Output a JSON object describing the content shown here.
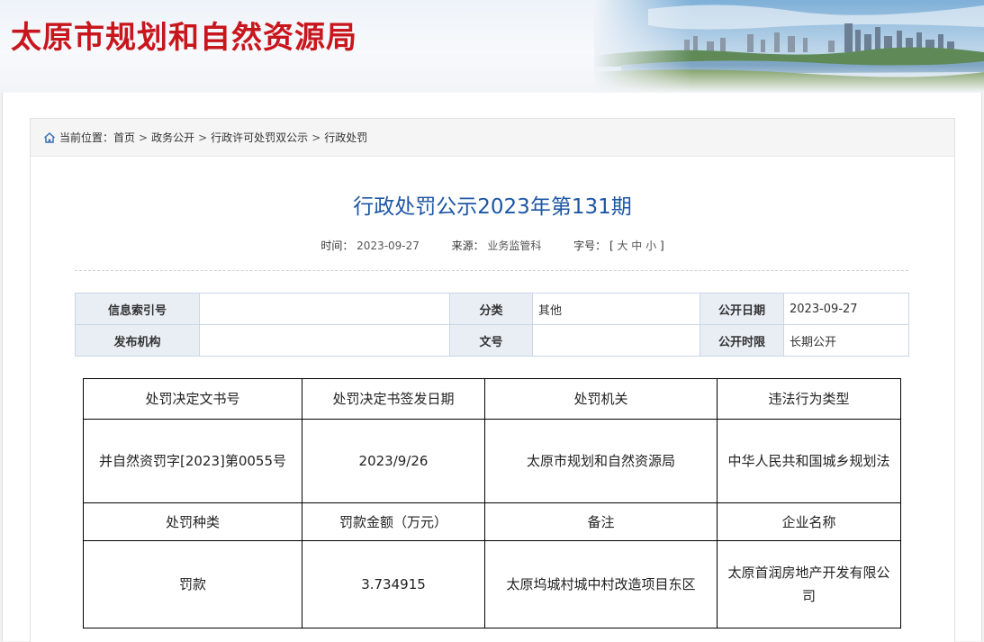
{
  "site": {
    "title": "太原市规划和自然资源局"
  },
  "breadcrumb": {
    "label": "当前位置：",
    "items": [
      "首页",
      "政务公开",
      "行政许可处罚双公示",
      "行政处罚"
    ],
    "separator": ">"
  },
  "article": {
    "title": "行政处罚公示2023年第131期",
    "meta": {
      "time_label": "时间：",
      "time": "2023-09-27",
      "source_label": "来源：",
      "source": "业务监管科",
      "fontsize_label": "字号：",
      "bracket_open": "[",
      "bracket_close": "]",
      "sizes": [
        "大",
        "中",
        "小"
      ]
    }
  },
  "info_table": {
    "rows": [
      [
        {
          "k": "信息索引号",
          "v": ""
        },
        {
          "k": "分类",
          "v": "其他"
        },
        {
          "k": "公开日期",
          "v": "2023-09-27"
        }
      ],
      [
        {
          "k": "发布机构",
          "v": ""
        },
        {
          "k": "文号",
          "v": ""
        },
        {
          "k": "公开时限",
          "v": "长期公开"
        }
      ]
    ]
  },
  "penalty_table": {
    "header1": [
      "处罚决定文书号",
      "处罚决定书签发日期",
      "处罚机关",
      "违法行为类型"
    ],
    "row1": [
      "并自然资罚字[2023]第0055号",
      "2023/9/26",
      "太原市规划和自然资源局",
      "中华人民共和国城乡规划法"
    ],
    "header2": [
      "处罚种类",
      "罚款金额（万元）",
      "备注",
      "企业名称"
    ],
    "row2": [
      "罚款",
      "3.734915",
      "太原坞城村城中村改造项目东区",
      "太原首润房地产开发有限公司"
    ]
  },
  "colors": {
    "title_red": "#c8161d",
    "article_blue": "#1d56a5",
    "info_key_bg": "#e9eef5"
  },
  "icons": {
    "breadcrumb": "home-icon"
  }
}
